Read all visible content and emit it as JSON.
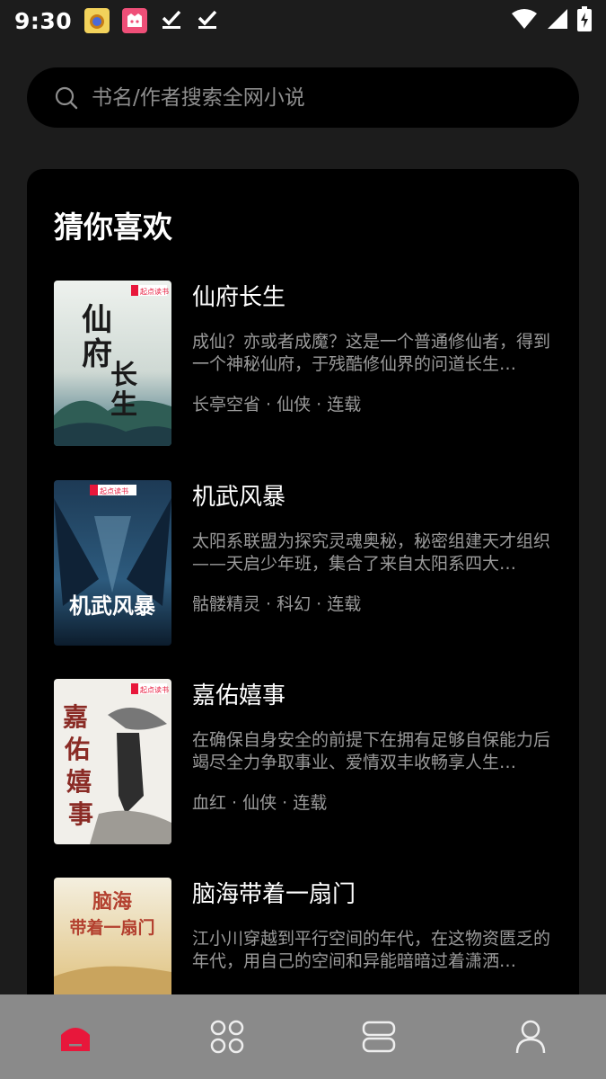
{
  "status_bar": {
    "time": "9:30",
    "icons": [
      "app-badge-yellow",
      "app-badge-pink",
      "download-check-icon",
      "download-check-icon",
      "wifi-icon",
      "signal-icon",
      "battery-charging-icon"
    ]
  },
  "search": {
    "placeholder": "书名/作者搜索全网小说",
    "value": ""
  },
  "section": {
    "title": "猜你喜欢"
  },
  "books": [
    {
      "title": "仙府长生",
      "description": "成仙？亦或者成魔？这是一个普通修仙者，得到一个神秘仙府，于残酷修仙界的问道长生…",
      "meta": "长亭空省 · 仙侠 · 连载",
      "cover_text": "仙府长生",
      "cover_publisher": "起点读书"
    },
    {
      "title": "机武风暴",
      "description": "太阳系联盟为探究灵魂奥秘，秘密组建天才组织——天启少年班，集合了来自太阳系四大…",
      "meta": "骷髅精灵 · 科幻 · 连载",
      "cover_text": "机武风暴",
      "cover_publisher": "起点读书"
    },
    {
      "title": "嘉佑嬉事",
      "description": "在确保自身安全的前提下在拥有足够自保能力后竭尽全力争取事业、爱情双丰收畅享人生…",
      "meta": "血红 · 仙侠 · 连载",
      "cover_text": "嘉佑嬉事",
      "cover_publisher": "起点读书"
    },
    {
      "title": "脑海带着一扇门",
      "description": "江小川穿越到平行空间的年代，在这物资匮乏的年代，用自己的空间和异能暗暗过着潇洒…",
      "meta": "",
      "cover_text": "脑海带着一扇门",
      "cover_publisher": ""
    }
  ],
  "bottom_nav": {
    "items": [
      "home-icon",
      "category-icon",
      "bookshelf-icon",
      "profile-icon"
    ],
    "active": "home-icon"
  },
  "colors": {
    "background": "#1c1c1c",
    "card": "#000000",
    "accent": "#e8173b",
    "muted_text": "#9a9a9a",
    "nav_bg": "#8a8a8a"
  }
}
